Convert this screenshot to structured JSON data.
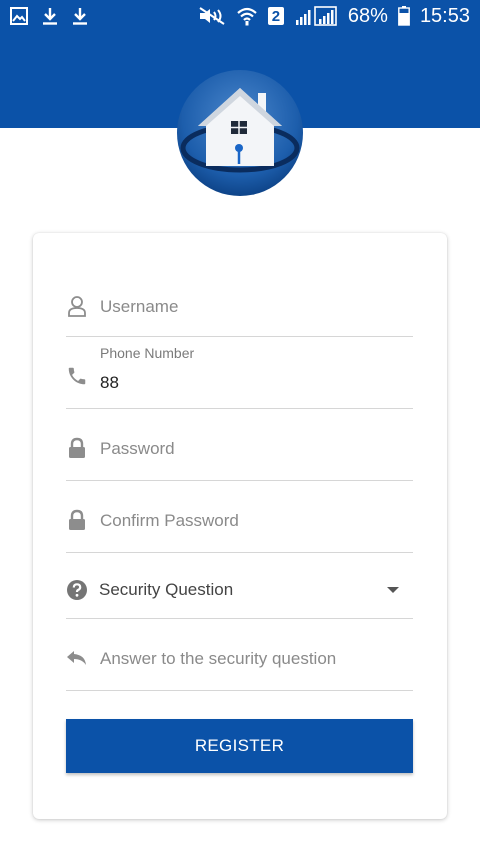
{
  "status_bar": {
    "battery": "68%",
    "time": "15:53",
    "sim_indicator": "2"
  },
  "form": {
    "username_placeholder": "Username",
    "phone_label": "Phone Number",
    "phone_value": "88",
    "password_placeholder": "Password",
    "confirm_password_placeholder": "Confirm Password",
    "security_question_label": "Security Question",
    "answer_placeholder": "Answer to the security question",
    "register_label": "REGISTER"
  },
  "colors": {
    "primary": "#0b52a8",
    "icon_gray": "#8d8d8d"
  }
}
